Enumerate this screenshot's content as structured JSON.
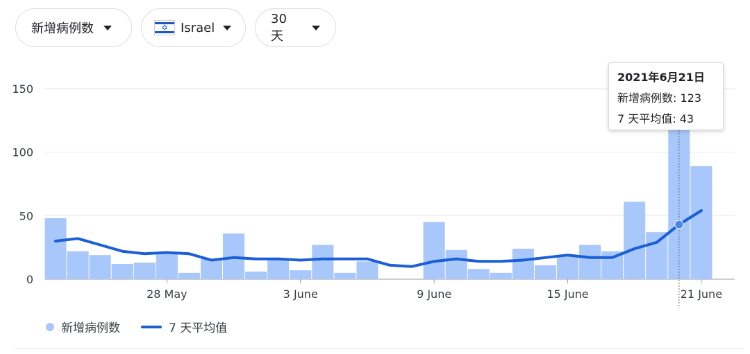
{
  "controls": {
    "metric_label": "新增病例数",
    "country_label": "Israel",
    "range_label": "30 天"
  },
  "tooltip": {
    "date": "2021年6月21日",
    "cases_line": "新增病例数: 123",
    "avg_line": "7 天平均值: 43"
  },
  "legend": {
    "bars_label": "新增病例数",
    "line_label": "7 天平均值"
  },
  "colors": {
    "bar": "#a8c7fa",
    "line": "#1a5fd6",
    "grid": "#e6e6e6"
  },
  "chart_data": {
    "type": "bar",
    "categories": [
      "23 May",
      "24 May",
      "25 May",
      "26 May",
      "27 May",
      "28 May",
      "29 May",
      "30 May",
      "31 May",
      "1 June",
      "2 June",
      "3 June",
      "4 June",
      "5 June",
      "6 June",
      "7 June",
      "8 June",
      "9 June",
      "10 June",
      "11 June",
      "12 June",
      "13 June",
      "14 June",
      "15 June",
      "16 June",
      "17 June",
      "18 June",
      "19 June",
      "20 June",
      "21 June",
      "22 June"
    ],
    "series": [
      {
        "name": "新增病例数",
        "type": "bar",
        "values": [
          48,
          22,
          19,
          12,
          13,
          21,
          5,
          16,
          36,
          6,
          16,
          7,
          27,
          5,
          14,
          0,
          0,
          45,
          23,
          8,
          5,
          24,
          11,
          19,
          27,
          22,
          61,
          37,
          123,
          89,
          0
        ]
      },
      {
        "name": "7 天平均值",
        "type": "line",
        "values": [
          30,
          32,
          27,
          22,
          20,
          21,
          20,
          15,
          17,
          16,
          16,
          15,
          16,
          16,
          16,
          11,
          10,
          14,
          16,
          14,
          14,
          15,
          17,
          19,
          17,
          17,
          24,
          29,
          43,
          54
        ]
      }
    ],
    "xticks": [
      "28 May",
      "3 June",
      "9 June",
      "15 June",
      "21 June"
    ],
    "xtick_index": [
      5,
      11,
      17,
      23,
      29
    ],
    "yticks": [
      0,
      50,
      100,
      150
    ],
    "ylim": [
      0,
      150
    ],
    "highlight_index": 28
  }
}
